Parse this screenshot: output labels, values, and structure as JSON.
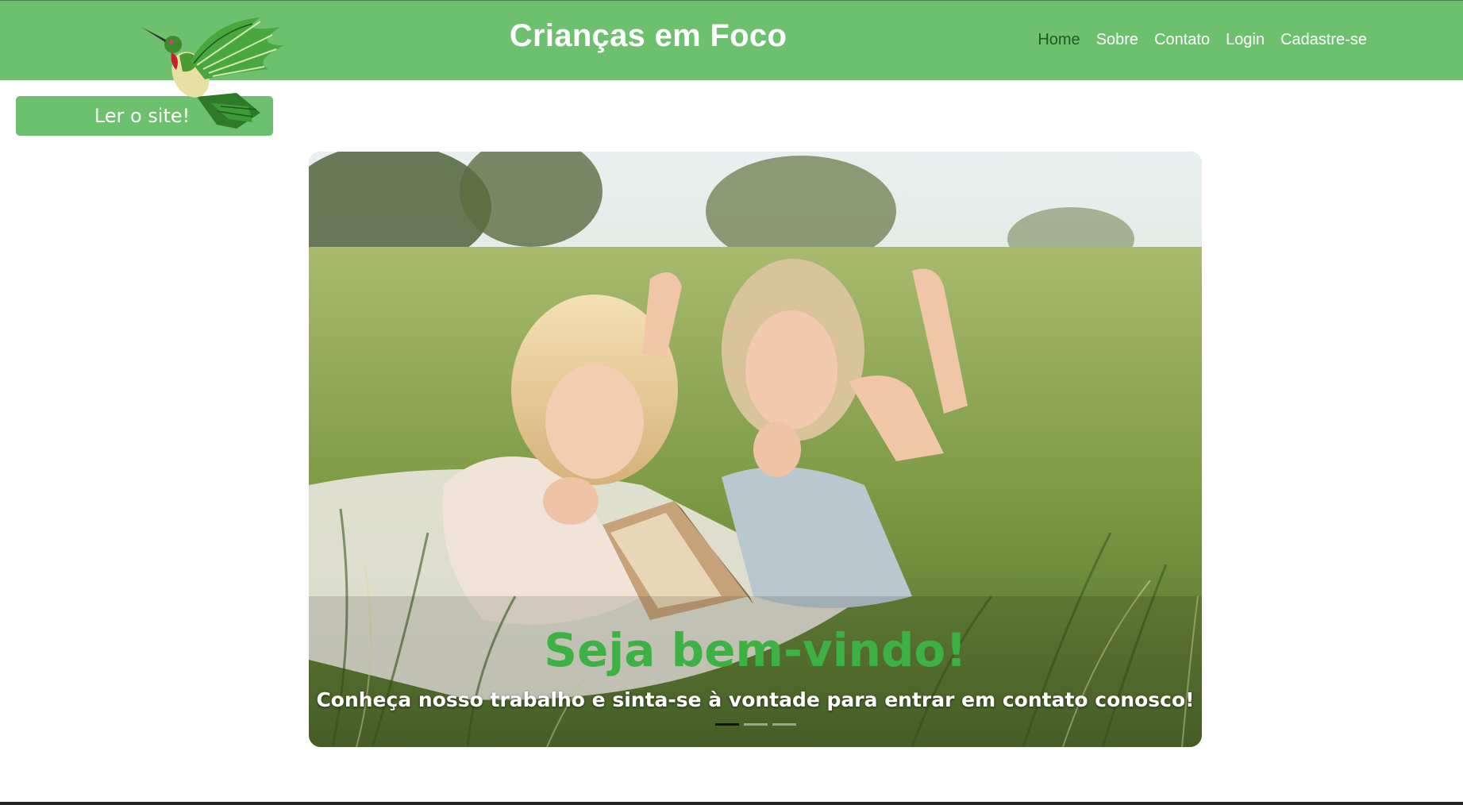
{
  "header": {
    "title": "Crianças em Foco",
    "nav": [
      {
        "label": "Home",
        "active": true
      },
      {
        "label": "Sobre",
        "active": false
      },
      {
        "label": "Contato",
        "active": false
      },
      {
        "label": "Login",
        "active": false
      },
      {
        "label": "Cadastre-se",
        "active": false
      }
    ]
  },
  "logo": {
    "icon": "hummingbird-icon"
  },
  "read_button": {
    "label": "Ler o site!"
  },
  "carousel": {
    "image": "photo of two girls lying in tall grass reading a book",
    "caption_title": "Seja bem-vindo!",
    "caption_text": "Conheça nosso trabalho e sinta-se à vontade para entrar em contato conosco!",
    "slide_count": 3,
    "active_slide": 1
  },
  "colors": {
    "header_bg": "#6cc06e",
    "nav_active": "#1d5a22",
    "caption_title": "#3eb144"
  }
}
